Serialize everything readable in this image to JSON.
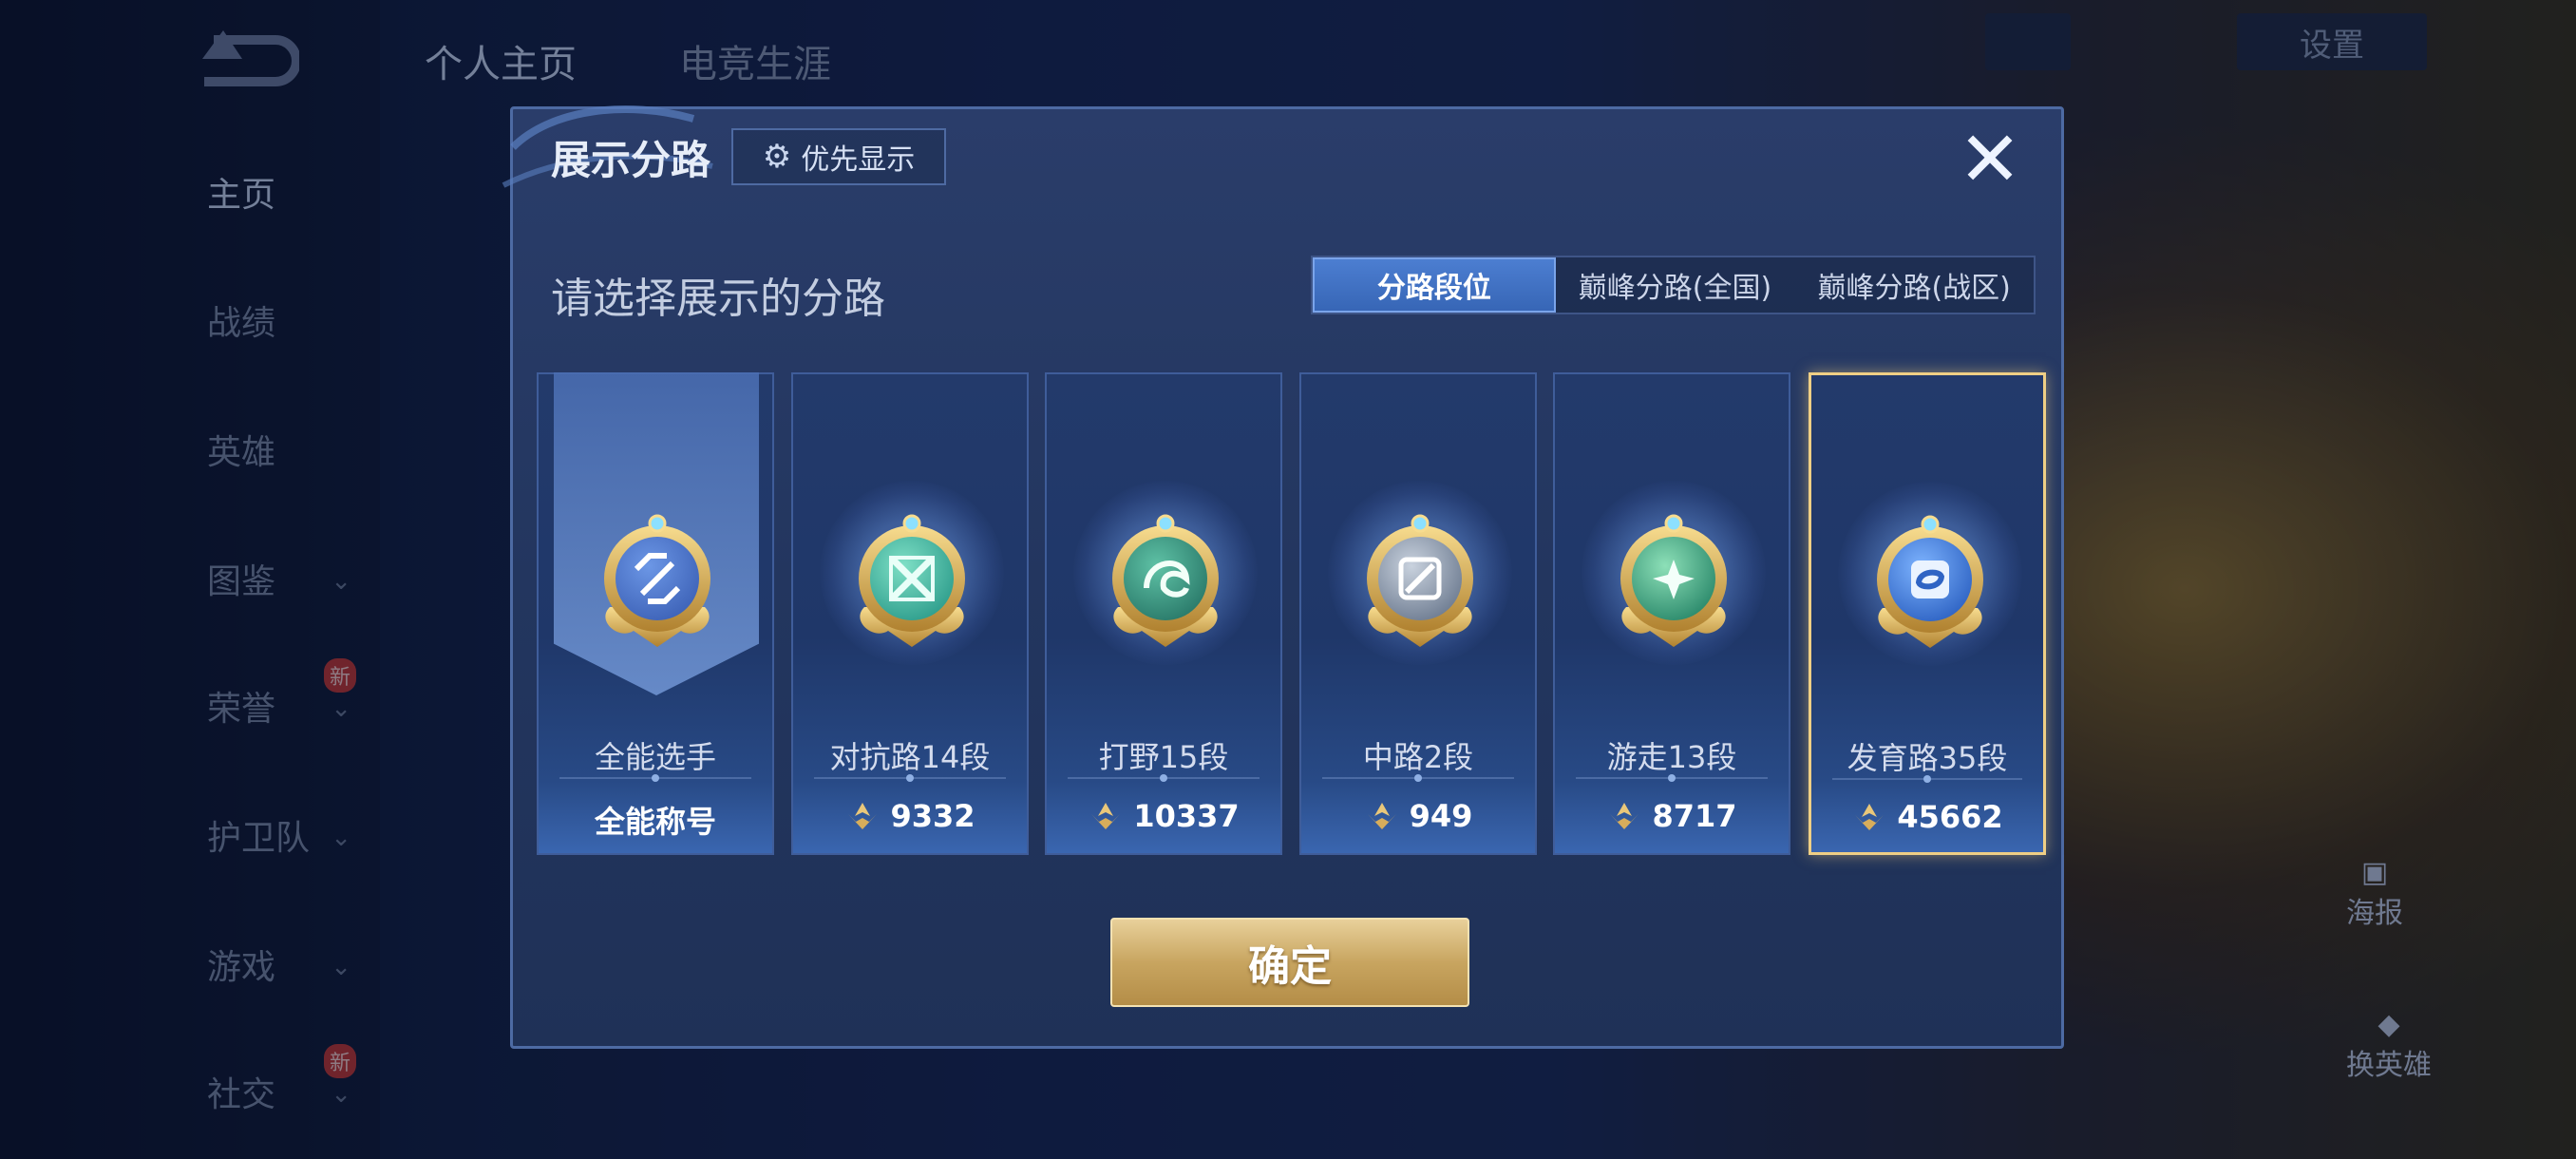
{
  "nav": {
    "top_tabs": [
      "个人主页",
      "电竞生涯"
    ],
    "side_items": [
      {
        "label": "主页",
        "chevron": false,
        "new": false
      },
      {
        "label": "战绩",
        "chevron": false,
        "new": false
      },
      {
        "label": "英雄",
        "chevron": false,
        "new": false
      },
      {
        "label": "图鉴",
        "chevron": true,
        "new": false
      },
      {
        "label": "荣誉",
        "chevron": true,
        "new": true
      },
      {
        "label": "护卫队",
        "chevron": true,
        "new": false
      },
      {
        "label": "游戏",
        "chevron": true,
        "new": false
      },
      {
        "label": "社交",
        "chevron": true,
        "new": true
      }
    ],
    "new_badge": "新",
    "settings_label": "设置",
    "right_poster": "海报",
    "right_change_hero": "换英雄"
  },
  "modal": {
    "title": "展示分路",
    "priority_button": "优先显示",
    "subtitle": "请选择展示的分路",
    "tabs": [
      "分路段位",
      "巅峰分路(全国)",
      "巅峰分路(战区)"
    ],
    "active_tab": 0,
    "cards": [
      {
        "name": "全能选手",
        "value": "全能称号",
        "has_peak_icon": false,
        "icon": "all-round-emblem-icon",
        "selected": false
      },
      {
        "name": "对抗路14段",
        "value": "9332",
        "has_peak_icon": true,
        "icon": "clash-lane-emblem-icon",
        "selected": false
      },
      {
        "name": "打野15段",
        "value": "10337",
        "has_peak_icon": true,
        "icon": "jungle-emblem-icon",
        "selected": false
      },
      {
        "name": "中路2段",
        "value": "949",
        "has_peak_icon": true,
        "icon": "mid-lane-emblem-icon",
        "selected": false
      },
      {
        "name": "游走13段",
        "value": "8717",
        "has_peak_icon": true,
        "icon": "roam-emblem-icon",
        "selected": false
      },
      {
        "name": "发育路35段",
        "value": "45662",
        "has_peak_icon": true,
        "icon": "farm-lane-emblem-icon",
        "selected": true
      }
    ],
    "confirm_label": "确定"
  },
  "colors": {
    "accent_gold": "#efcf85",
    "tab_active": "#3f72c4",
    "modal_bg": "#26395f"
  }
}
